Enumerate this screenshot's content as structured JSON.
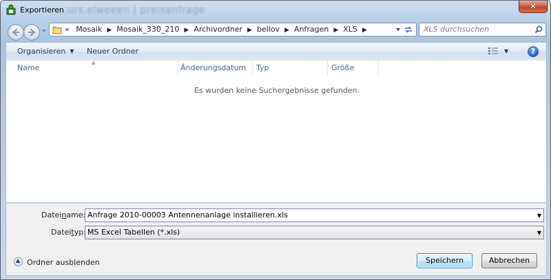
{
  "window": {
    "title": "Exportieren",
    "background_ghost_text": "...urs.elweeen | preisanfrage"
  },
  "address_bar": {
    "overflow": "«",
    "breadcrumbs": [
      "Mosaik",
      "Mosaik_330_210",
      "Archivordner",
      "bellov",
      "Anfragen",
      "XLS"
    ]
  },
  "search": {
    "placeholder": "XLS durchsuchen"
  },
  "toolbar": {
    "organize_label": "Organisieren",
    "new_folder_label": "Neuer Ordner",
    "help_label": "?"
  },
  "columns": [
    "Name",
    "Änderungsdatum",
    "Typ",
    "Größe"
  ],
  "list": {
    "empty_message": "Es wurden keine Suchergebnisse gefunden."
  },
  "form": {
    "filename_label_pre": "Datei",
    "filename_label_ul": "n",
    "filename_label_post": "ame:",
    "filename_value": "Anfrage 2010-00003 Antennenanlage installieren.xls",
    "filetype_label_pre": "Datei",
    "filetype_label_ul": "t",
    "filetype_label_post": "yp:",
    "filetype_value": "MS Excel Tabellen (*.xls)"
  },
  "footer": {
    "hide_folders_label": "Ordner ausblenden",
    "save_label": "Speichern",
    "cancel_label": "Abbrechen"
  },
  "colors": {
    "frame": "#bfd3e6",
    "close": "#c7442b",
    "command_text": "#1e395b",
    "default_button_border": "#3c7fb1"
  }
}
